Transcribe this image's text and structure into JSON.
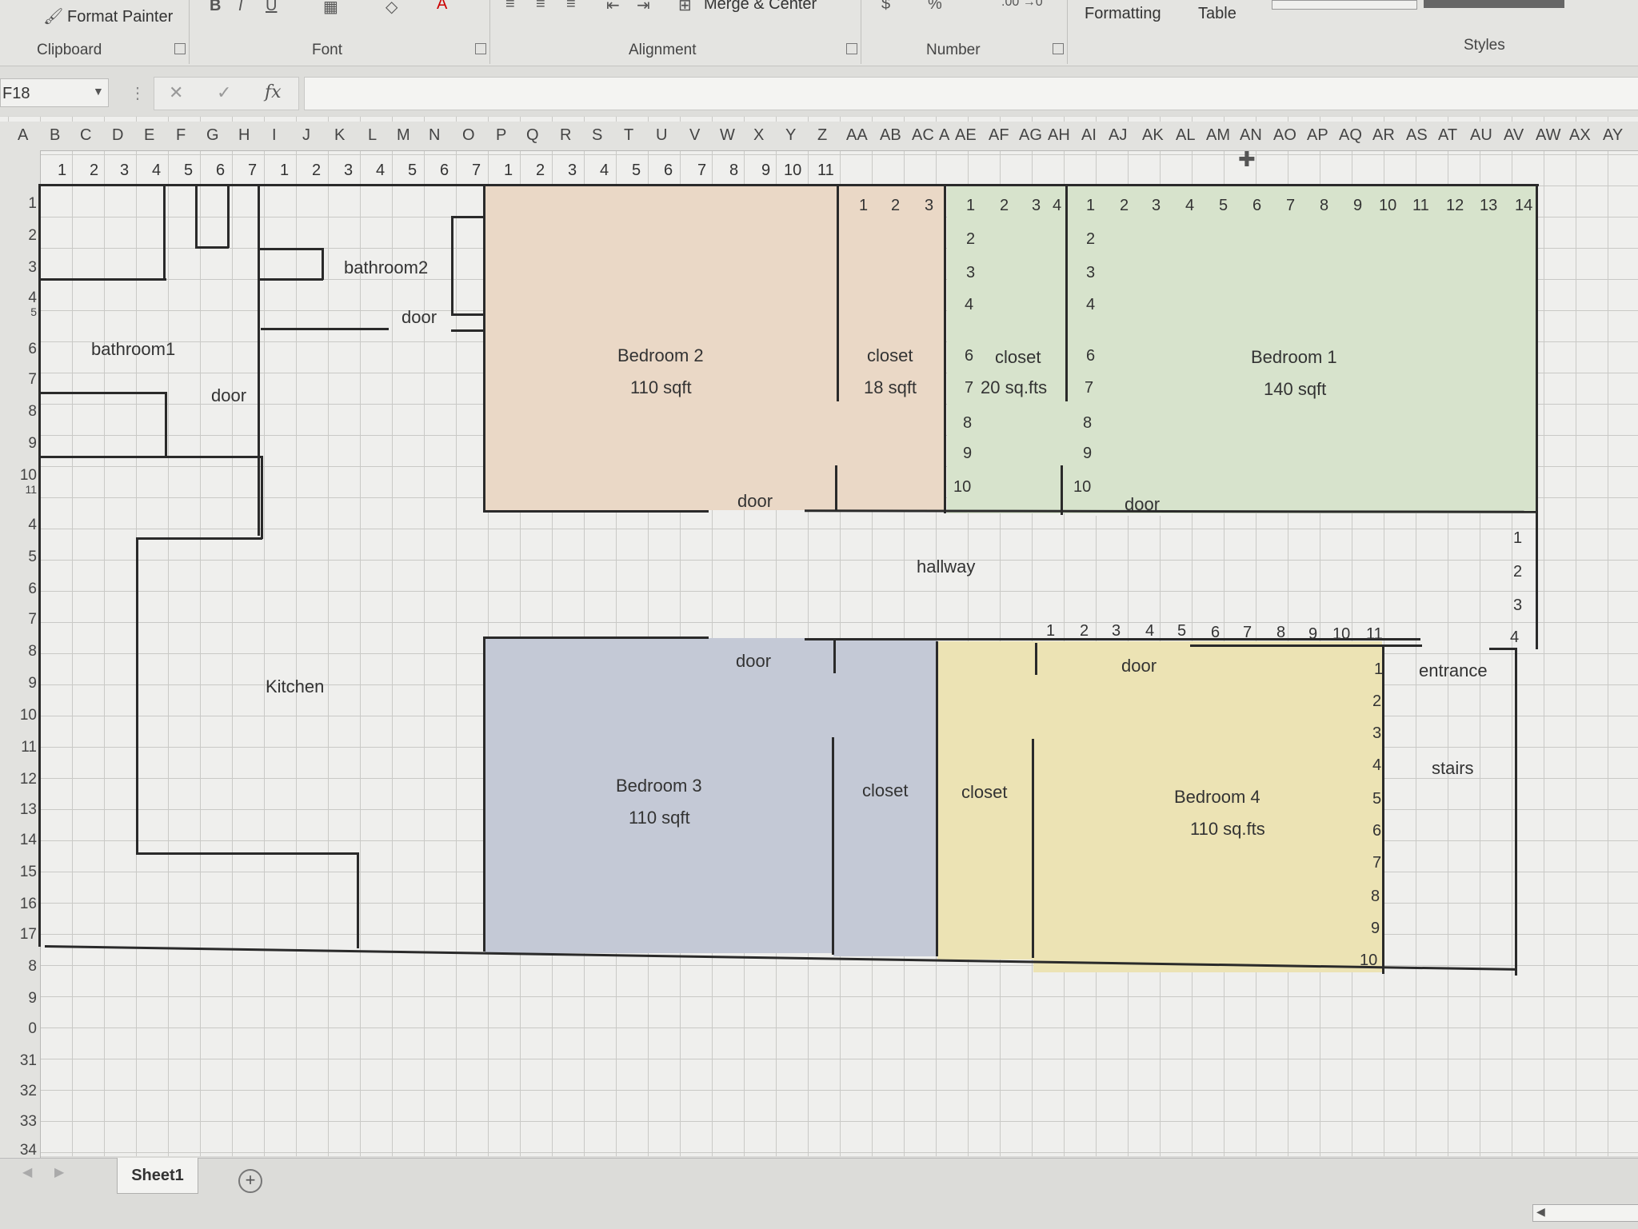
{
  "ribbon": {
    "format_painter": "Format Painter",
    "groups": {
      "clipboard": "Clipboard",
      "font": "Font",
      "alignment": "Alignment",
      "number": "Number",
      "styles": "Styles"
    },
    "merge_center": "Merge & Center",
    "conditional_formatting": "Formatting",
    "format_as_table": "Table"
  },
  "formula_bar": {
    "name_box": "F18",
    "cancel": "✕",
    "enter": "✓",
    "fx": "fx",
    "formula": ""
  },
  "columns": [
    "A",
    "B",
    "C",
    "D",
    "E",
    "F",
    "G",
    "H",
    "I",
    "J",
    "K",
    "L",
    "M",
    "N",
    "O",
    "P",
    "Q",
    "R",
    "S",
    "T",
    "U",
    "V",
    "W",
    "X",
    "Y",
    "Z",
    "AA",
    "AB",
    "AC",
    "A",
    "AE",
    "AF",
    "AG",
    "AH",
    "AI",
    "AJ",
    "AK",
    "AL",
    "AM",
    "AN",
    "AO",
    "AP",
    "AQ",
    "AR",
    "AS",
    "AT",
    "AU",
    "AV",
    "AW",
    "AX",
    "AY"
  ],
  "rows": [
    "1",
    "2",
    "3",
    "4",
    "5",
    "6",
    "7",
    "8",
    "9",
    "10",
    "11",
    "4",
    "5",
    "6",
    "7",
    "8",
    "9",
    "10",
    "11",
    "12",
    "13",
    "14",
    "15",
    "16",
    "17",
    "8",
    "9",
    "0",
    "31",
    "32",
    "33",
    "34"
  ],
  "ruler_top": [
    "1",
    "2",
    "3",
    "4",
    "5",
    "6",
    "7",
    "1",
    "2",
    "3",
    "4",
    "5",
    "6",
    "7",
    "1",
    "2",
    "3",
    "4",
    "5",
    "6",
    "7",
    "8",
    "9",
    "10",
    "11"
  ],
  "plan": {
    "bathroom1": "bathroom1",
    "bathroom2": "bathroom2",
    "door": "door",
    "kitchen": "Kitchen",
    "hallway": "hallway",
    "bedroom1": {
      "name": "Bedroom 1",
      "area": "140 sqft"
    },
    "bedroom2": {
      "name": "Bedroom 2",
      "area": "110 sqft"
    },
    "bedroom3": {
      "name": "Bedroom 3",
      "area": "110 sqft"
    },
    "bedroom4": {
      "name": "Bedroom 4",
      "area": "110 sq.fts"
    },
    "closet_b2": {
      "name": "closet",
      "area": "18 sqft"
    },
    "closet_b1": {
      "name": "closet",
      "area": "20 sq.fts"
    },
    "closet": "closet",
    "entrance": "entrance",
    "stairs": "stairs",
    "closet2_ruler": [
      "1",
      "2",
      "3"
    ],
    "closet1_top_ruler": [
      "1",
      "2",
      "3",
      "4"
    ],
    "closet1_side_ruler": [
      "2",
      "3",
      "4",
      "6",
      "7",
      "8",
      "9",
      "10"
    ],
    "bedroom1_top_ruler": [
      "1",
      "2",
      "3",
      "4",
      "5",
      "6",
      "7",
      "8",
      "9",
      "10",
      "11",
      "12",
      "13",
      "14"
    ],
    "bedroom1_side_ruler": [
      "2",
      "3",
      "4",
      "6",
      "7",
      "8",
      "9",
      "10"
    ],
    "hall_side_ruler": [
      "1",
      "2",
      "3",
      "4"
    ],
    "hall_bottom_ruler": [
      "1",
      "2",
      "3",
      "4",
      "5",
      "6",
      "7",
      "8",
      "9",
      "10",
      "11"
    ],
    "bedroom4_side_ruler": [
      "1",
      "2",
      "3",
      "4",
      "5",
      "6",
      "7",
      "8",
      "9",
      "10"
    ]
  },
  "sheet": {
    "tab": "Sheet1",
    "add": "+"
  }
}
